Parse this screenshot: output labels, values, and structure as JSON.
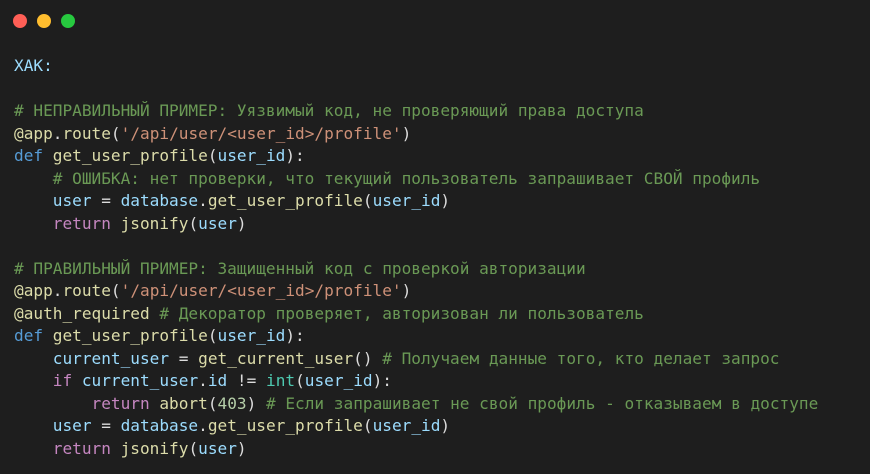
{
  "theme": {
    "background": "#1e1e1e",
    "window_controls": [
      "#ff5f56",
      "#ffbd2e",
      "#27c93f"
    ],
    "colors": {
      "comment": "#6a9955",
      "string": "#ce9178",
      "keyword": "#569cd6",
      "control": "#c586c0",
      "function": "#dcdcaa",
      "variable": "#9cdcfe",
      "number": "#b5cea8",
      "builtin": "#4ec9b0",
      "plain": "#dcdcdc"
    }
  },
  "lines": [
    [
      {
        "t": "ХАК:",
        "c": "label"
      }
    ],
    [],
    [
      {
        "t": "# НЕПРАВИЛЬНЫЙ ПРИМЕР: Уязвимый код, не проверяющий права доступа",
        "c": "comment"
      }
    ],
    [
      {
        "t": "@app",
        "c": "func"
      },
      {
        "t": ".",
        "c": "plain"
      },
      {
        "t": "route",
        "c": "func"
      },
      {
        "t": "(",
        "c": "plain"
      },
      {
        "t": "'/api/user/<user_id>/profile'",
        "c": "string"
      },
      {
        "t": ")",
        "c": "plain"
      }
    ],
    [
      {
        "t": "def",
        "c": "keyword"
      },
      {
        "t": " ",
        "c": "plain"
      },
      {
        "t": "get_user_profile",
        "c": "func"
      },
      {
        "t": "(",
        "c": "plain"
      },
      {
        "t": "user_id",
        "c": "var"
      },
      {
        "t": "):",
        "c": "plain"
      }
    ],
    [
      {
        "t": "    ",
        "c": "plain"
      },
      {
        "t": "# ОШИБКА: нет проверки, что текущий пользователь запрашивает СВОЙ профиль",
        "c": "comment"
      }
    ],
    [
      {
        "t": "    ",
        "c": "plain"
      },
      {
        "t": "user",
        "c": "var"
      },
      {
        "t": " = ",
        "c": "plain"
      },
      {
        "t": "database",
        "c": "var"
      },
      {
        "t": ".",
        "c": "plain"
      },
      {
        "t": "get_user_profile",
        "c": "func"
      },
      {
        "t": "(",
        "c": "plain"
      },
      {
        "t": "user_id",
        "c": "var"
      },
      {
        "t": ")",
        "c": "plain"
      }
    ],
    [
      {
        "t": "    ",
        "c": "plain"
      },
      {
        "t": "return",
        "c": "control"
      },
      {
        "t": " ",
        "c": "plain"
      },
      {
        "t": "jsonify",
        "c": "func"
      },
      {
        "t": "(",
        "c": "plain"
      },
      {
        "t": "user",
        "c": "var"
      },
      {
        "t": ")",
        "c": "plain"
      }
    ],
    [],
    [
      {
        "t": "# ПРАВИЛЬНЫЙ ПРИМЕР: Защищенный код с проверкой авторизации",
        "c": "comment"
      }
    ],
    [
      {
        "t": "@app",
        "c": "func"
      },
      {
        "t": ".",
        "c": "plain"
      },
      {
        "t": "route",
        "c": "func"
      },
      {
        "t": "(",
        "c": "plain"
      },
      {
        "t": "'/api/user/<user_id>/profile'",
        "c": "string"
      },
      {
        "t": ")",
        "c": "plain"
      }
    ],
    [
      {
        "t": "@auth_required",
        "c": "func"
      },
      {
        "t": " ",
        "c": "plain"
      },
      {
        "t": "# Декоратор проверяет, авторизован ли пользователь",
        "c": "comment"
      }
    ],
    [
      {
        "t": "def",
        "c": "keyword"
      },
      {
        "t": " ",
        "c": "plain"
      },
      {
        "t": "get_user_profile",
        "c": "func"
      },
      {
        "t": "(",
        "c": "plain"
      },
      {
        "t": "user_id",
        "c": "var"
      },
      {
        "t": "):",
        "c": "plain"
      }
    ],
    [
      {
        "t": "    ",
        "c": "plain"
      },
      {
        "t": "current_user",
        "c": "var"
      },
      {
        "t": " = ",
        "c": "plain"
      },
      {
        "t": "get_current_user",
        "c": "func"
      },
      {
        "t": "() ",
        "c": "plain"
      },
      {
        "t": "# Получаем данные того, кто делает запрос",
        "c": "comment"
      }
    ],
    [
      {
        "t": "    ",
        "c": "plain"
      },
      {
        "t": "if",
        "c": "control"
      },
      {
        "t": " ",
        "c": "plain"
      },
      {
        "t": "current_user",
        "c": "var"
      },
      {
        "t": ".",
        "c": "plain"
      },
      {
        "t": "id",
        "c": "var"
      },
      {
        "t": " != ",
        "c": "plain"
      },
      {
        "t": "int",
        "c": "builtin"
      },
      {
        "t": "(",
        "c": "plain"
      },
      {
        "t": "user_id",
        "c": "var"
      },
      {
        "t": "):",
        "c": "plain"
      }
    ],
    [
      {
        "t": "        ",
        "c": "plain"
      },
      {
        "t": "return",
        "c": "control"
      },
      {
        "t": " ",
        "c": "plain"
      },
      {
        "t": "abort",
        "c": "func"
      },
      {
        "t": "(",
        "c": "plain"
      },
      {
        "t": "403",
        "c": "number"
      },
      {
        "t": ") ",
        "c": "plain"
      },
      {
        "t": "# Если запрашивает не свой профиль - отказываем в доступе",
        "c": "comment"
      }
    ],
    [
      {
        "t": "    ",
        "c": "plain"
      },
      {
        "t": "user",
        "c": "var"
      },
      {
        "t": " = ",
        "c": "plain"
      },
      {
        "t": "database",
        "c": "var"
      },
      {
        "t": ".",
        "c": "plain"
      },
      {
        "t": "get_user_profile",
        "c": "func"
      },
      {
        "t": "(",
        "c": "plain"
      },
      {
        "t": "user_id",
        "c": "var"
      },
      {
        "t": ")",
        "c": "plain"
      }
    ],
    [
      {
        "t": "    ",
        "c": "plain"
      },
      {
        "t": "return",
        "c": "control"
      },
      {
        "t": " ",
        "c": "plain"
      },
      {
        "t": "jsonify",
        "c": "func"
      },
      {
        "t": "(",
        "c": "plain"
      },
      {
        "t": "user",
        "c": "var"
      },
      {
        "t": ")",
        "c": "plain"
      }
    ]
  ]
}
